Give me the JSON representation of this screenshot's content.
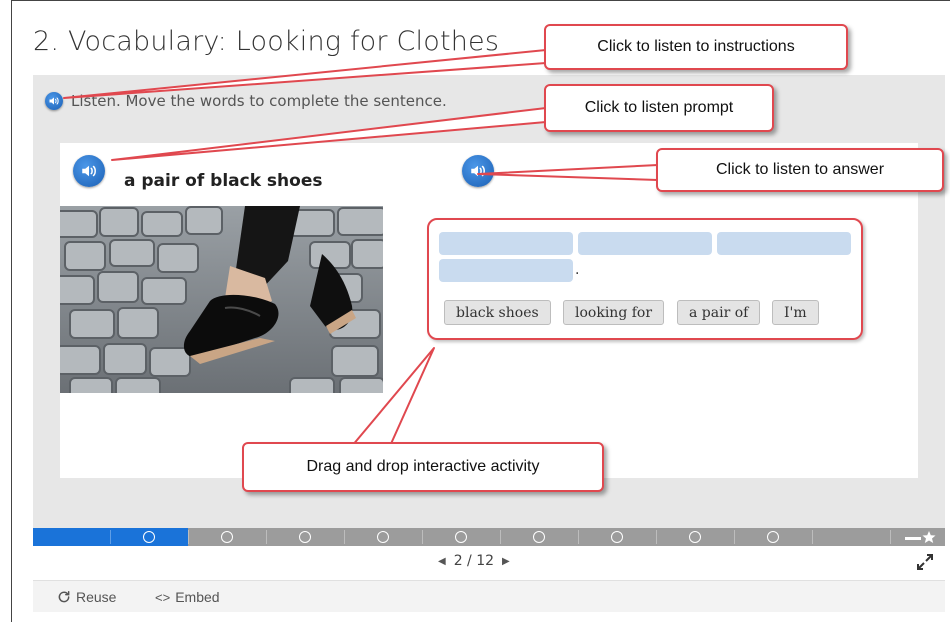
{
  "page": {
    "title": "2. Vocabulary: Looking for Clothes"
  },
  "instructions": {
    "text": "Listen. Move the words to complete the sentence."
  },
  "prompt": {
    "text": "a pair of black shoes"
  },
  "words": [
    "black shoes",
    "looking for",
    "a pair of",
    "I'm"
  ],
  "drop": {
    "punctuation": "."
  },
  "progress": {
    "current": 2,
    "total": 12,
    "page_label": "2 / 12"
  },
  "footer": {
    "reuse_label": "Reuse",
    "embed_label": "Embed"
  },
  "callouts": {
    "instructions": "Click to listen to instructions",
    "prompt": "Click to listen prompt",
    "answer": "Click to listen to answer",
    "activity": "Drag and drop interactive activity"
  },
  "colors": {
    "accent": "#1a73d9",
    "callout_border": "#e0484f",
    "slot": "#c9dbef"
  }
}
